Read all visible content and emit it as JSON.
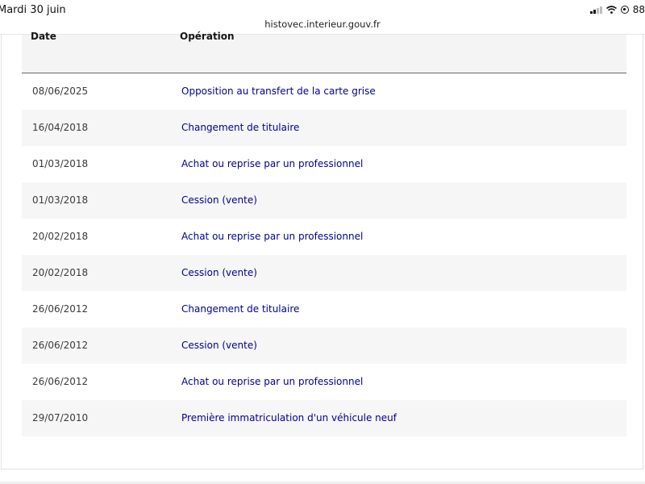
{
  "status_bar": {
    "time": "Mardi 30 juin",
    "url": "histovec.interieur.gouv.fr",
    "battery": "88"
  },
  "table": {
    "headers": {
      "date": "Date",
      "operation": "Opération"
    },
    "rows": [
      {
        "date": "08/06/2025",
        "operation": "Opposition au transfert de la carte grise"
      },
      {
        "date": "16/04/2018",
        "operation": "Changement de titulaire"
      },
      {
        "date": "01/03/2018",
        "operation": "Achat ou reprise par un professionnel"
      },
      {
        "date": "01/03/2018",
        "operation": "Cession (vente)"
      },
      {
        "date": "20/02/2018",
        "operation": "Achat ou reprise par un professionnel"
      },
      {
        "date": "20/02/2018",
        "operation": "Cession (vente)"
      },
      {
        "date": "26/06/2012",
        "operation": "Changement de titulaire"
      },
      {
        "date": "26/06/2012",
        "operation": "Cession (vente)"
      },
      {
        "date": "26/06/2012",
        "operation": "Achat ou reprise par un professionnel"
      },
      {
        "date": "29/07/2010",
        "operation": "Première immatriculation d'un véhicule neuf"
      }
    ]
  },
  "colors": {
    "link": "#000091",
    "header_bg": "#f4f4f4",
    "row_alt_bg": "#f6f6f6"
  }
}
